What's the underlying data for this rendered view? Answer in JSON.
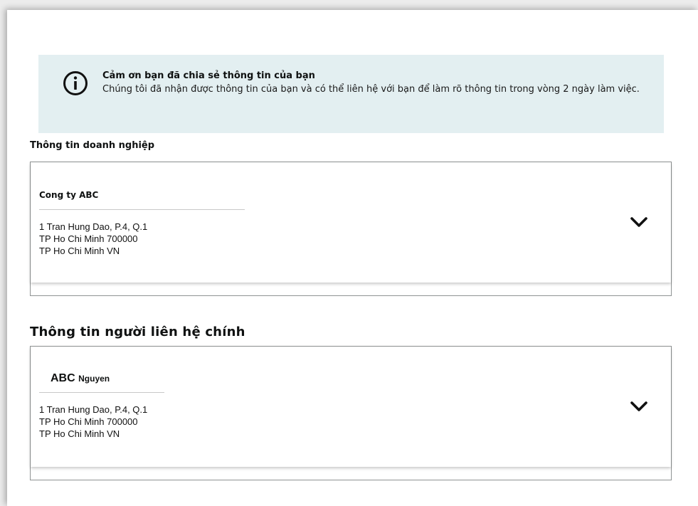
{
  "banner": {
    "icon": "info-circle-icon",
    "title": "Cảm ơn bạn đã chia sẻ thông tin của bạn",
    "message": "Chúng tôi đã nhận được thông tin của bạn và có thể liên hệ với bạn để làm rõ thông tin trong vòng 2 ngày làm việc."
  },
  "business": {
    "section_title": "Thông tin doanh nghiệp",
    "name": "Cong ty ABC",
    "address_line1": "1 Tran Hung Dao, P.4, Q.1",
    "address_line2": "TP Ho Chi Minh 700000",
    "address_line3": "TP Ho Chi Minh VN",
    "expand_icon": "chevron-down-icon"
  },
  "contact": {
    "section_title": "Thông tin người liên hệ chính",
    "first_name": "ABC",
    "last_name": "Nguyen",
    "address_line1": "1 Tran Hung Dao, P.4, Q.1",
    "address_line2": "TP Ho Chi Minh 700000",
    "address_line3": "TP Ho Chi Minh VN",
    "expand_icon": "chevron-down-icon"
  }
}
